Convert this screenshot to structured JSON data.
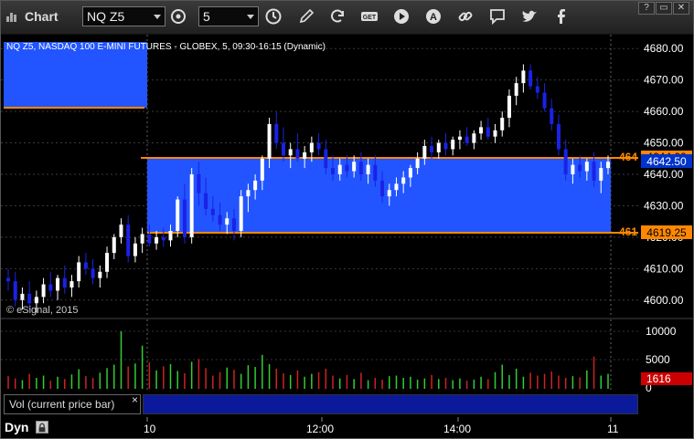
{
  "toolbar": {
    "app_title": "Chart",
    "symbol": "NQ Z5",
    "interval": "5"
  },
  "window_controls": {
    "menu": "?",
    "restore": "▭",
    "close": "✕"
  },
  "chart": {
    "study_title": "NQ Z5, NASDAQ 100 E-MINI FUTURES - GLOBEX, 5, 09:30-16:15 (Dynamic)",
    "watermark": "© eSignal, 2015",
    "price_ticks": [
      "4680.00",
      "4670.00",
      "4660.00",
      "4650.00",
      "4640.00",
      "4630.00",
      "4620.00",
      "4610.00",
      "4600.00"
    ],
    "current_price": "4642.50",
    "upper_level": {
      "left_text": "464",
      "right_text": "4644.00"
    },
    "lower_level": {
      "left_text": "461",
      "right_text": "4619.25"
    },
    "time_labels": [
      "10",
      "12:00",
      "14:00",
      "11"
    ]
  },
  "volume": {
    "label": "Vol (current price bar)",
    "close_glyph": "×",
    "ticks": [
      "10000",
      "5000",
      "0"
    ],
    "current_value": "1616"
  },
  "status": {
    "mode": "Dyn"
  },
  "colors": {
    "up_candle": "#ffffff",
    "down_candle": "#1a22e6",
    "zone_fill": "#2255ff",
    "level_line": "#ff8800",
    "vol_up": "#33cc33",
    "vol_down": "#cc2222",
    "current_price_bg": "#0033cc",
    "volume_badge_bg": "#cc0000"
  },
  "chart_data": {
    "type": "candlestick",
    "ylim": [
      4595,
      4685
    ],
    "candles": [
      [
        4607,
        4610,
        4603,
        4606
      ],
      [
        4606,
        4609,
        4598,
        4600
      ],
      [
        4600,
        4604,
        4597,
        4602
      ],
      [
        4602,
        4606,
        4597,
        4599
      ],
      [
        4599,
        4603,
        4596,
        4601
      ],
      [
        4601,
        4607,
        4599,
        4605
      ],
      [
        4605,
        4609,
        4601,
        4603
      ],
      [
        4603,
        4608,
        4600,
        4607
      ],
      [
        4607,
        4611,
        4602,
        4604
      ],
      [
        4604,
        4608,
        4601,
        4606
      ],
      [
        4606,
        4614,
        4604,
        4612
      ],
      [
        4612,
        4615,
        4608,
        4610
      ],
      [
        4610,
        4613,
        4605,
        4607
      ],
      [
        4607,
        4611,
        4604,
        4609
      ],
      [
        4609,
        4617,
        4607,
        4615
      ],
      [
        4615,
        4621,
        4613,
        4620
      ],
      [
        4620,
        4626,
        4618,
        4624
      ],
      [
        4624,
        4627,
        4612,
        4614
      ],
      [
        4614,
        4620,
        4612,
        4618
      ],
      [
        4618,
        4623,
        4615,
        4621
      ],
      [
        4621,
        4624,
        4617,
        4618
      ],
      [
        4618,
        4622,
        4616,
        4620
      ],
      [
        4620,
        4623,
        4617,
        4619
      ],
      [
        4619,
        4624,
        4617,
        4622
      ],
      [
        4622,
        4633,
        4620,
        4632
      ],
      [
        4632,
        4637,
        4618,
        4620
      ],
      [
        4620,
        4642,
        4618,
        4640
      ],
      [
        4640,
        4644,
        4630,
        4634
      ],
      [
        4634,
        4639,
        4627,
        4629
      ],
      [
        4629,
        4633,
        4625,
        4627
      ],
      [
        4627,
        4631,
        4622,
        4624
      ],
      [
        4624,
        4628,
        4621,
        4626
      ],
      [
        4626,
        4629,
        4619,
        4622
      ],
      [
        4622,
        4635,
        4620,
        4633
      ],
      [
        4633,
        4637,
        4628,
        4635
      ],
      [
        4635,
        4640,
        4632,
        4638
      ],
      [
        4638,
        4646,
        4635,
        4645
      ],
      [
        4645,
        4658,
        4642,
        4656
      ],
      [
        4656,
        4660,
        4648,
        4650
      ],
      [
        4650,
        4655,
        4644,
        4646
      ],
      [
        4646,
        4650,
        4642,
        4648
      ],
      [
        4648,
        4653,
        4644,
        4645
      ],
      [
        4645,
        4649,
        4642,
        4647
      ],
      [
        4647,
        4652,
        4644,
        4650
      ],
      [
        4650,
        4653,
        4646,
        4648
      ],
      [
        4648,
        4651,
        4640,
        4642
      ],
      [
        4642,
        4646,
        4638,
        4640
      ],
      [
        4640,
        4645,
        4638,
        4643
      ],
      [
        4643,
        4646,
        4639,
        4641
      ],
      [
        4641,
        4646,
        4639,
        4644
      ],
      [
        4644,
        4647,
        4638,
        4640
      ],
      [
        4640,
        4645,
        4637,
        4643
      ],
      [
        4643,
        4646,
        4636,
        4638
      ],
      [
        4638,
        4641,
        4631,
        4633
      ],
      [
        4633,
        4637,
        4630,
        4635
      ],
      [
        4635,
        4639,
        4633,
        4637
      ],
      [
        4637,
        4641,
        4634,
        4639
      ],
      [
        4639,
        4643,
        4636,
        4642
      ],
      [
        4642,
        4647,
        4640,
        4645
      ],
      [
        4645,
        4651,
        4643,
        4649
      ],
      [
        4649,
        4652,
        4645,
        4647
      ],
      [
        4647,
        4651,
        4645,
        4650
      ],
      [
        4650,
        4653,
        4646,
        4648
      ],
      [
        4648,
        4652,
        4646,
        4651
      ],
      [
        4651,
        4654,
        4648,
        4652
      ],
      [
        4652,
        4655,
        4649,
        4650
      ],
      [
        4650,
        4654,
        4648,
        4653
      ],
      [
        4653,
        4657,
        4651,
        4655
      ],
      [
        4655,
        4658,
        4651,
        4652
      ],
      [
        4652,
        4656,
        4650,
        4654
      ],
      [
        4654,
        4660,
        4652,
        4658
      ],
      [
        4658,
        4667,
        4655,
        4665
      ],
      [
        4665,
        4671,
        4662,
        4669
      ],
      [
        4669,
        4675,
        4666,
        4673
      ],
      [
        4673,
        4675,
        4667,
        4668
      ],
      [
        4668,
        4671,
        4664,
        4666
      ],
      [
        4666,
        4669,
        4660,
        4661
      ],
      [
        4661,
        4664,
        4654,
        4656
      ],
      [
        4656,
        4659,
        4646,
        4648
      ],
      [
        4648,
        4651,
        4638,
        4640
      ],
      [
        4640,
        4645,
        4637,
        4643
      ],
      [
        4643,
        4646,
        4639,
        4641
      ],
      [
        4641,
        4645,
        4638,
        4644
      ],
      [
        4644,
        4647,
        4636,
        4638
      ],
      [
        4638,
        4644,
        4634,
        4642
      ],
      [
        4642,
        4646,
        4640,
        4644
      ]
    ],
    "volumes": [
      2200,
      1800,
      1500,
      2600,
      1900,
      2300,
      1400,
      2100,
      1700,
      2500,
      3400,
      2200,
      1900,
      2800,
      3600,
      4200,
      10000,
      3900,
      4400,
      7500,
      4600,
      3200,
      3900,
      4300,
      3100,
      2700,
      4700,
      5200,
      3600,
      2300,
      2900,
      3700,
      3300,
      2600,
      4100,
      3800,
      5900,
      4300,
      3500,
      2700,
      2400,
      3200,
      2100,
      2600,
      2900,
      3500,
      2300,
      1800,
      2400,
      1700,
      2800,
      1500,
      1900,
      1600,
      2200,
      2300,
      1900,
      2100,
      1600,
      1800,
      2400,
      1700,
      1900,
      1500,
      1800,
      1400,
      1600,
      2100,
      1700,
      2900,
      4200,
      2400,
      3500,
      2100,
      2800,
      2300,
      2600,
      3000,
      2300,
      1900,
      2200,
      2000,
      3200,
      5600,
      2300,
      2600
    ]
  }
}
